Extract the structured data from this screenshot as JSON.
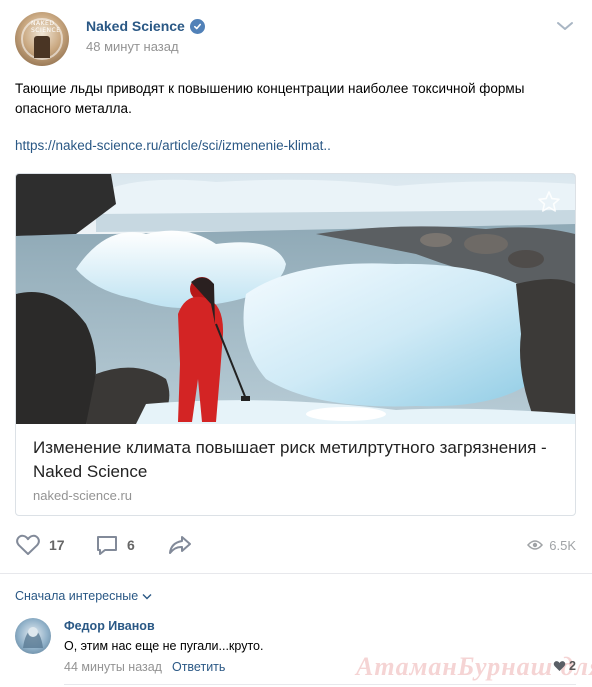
{
  "post": {
    "author": "Naked Science",
    "time": "48 минут назад",
    "text": "Тающие льды приводят к повышению концентрации наиболее токсичной формы опасного металла.",
    "link": "https://naked-science.ru/article/sci/izmenenie-klimat..",
    "avatar_caption": "NAKED SCIENCE"
  },
  "card": {
    "title": "Изменение климата повышает риск метилртутного загрязнения - Naked Science",
    "domain": "naked-science.ru"
  },
  "actions": {
    "likes": "17",
    "comments": "6",
    "views": "6.5K"
  },
  "comments": {
    "sort_label": "Сначала интересные",
    "items": [
      {
        "name": "Федор Иванов",
        "text": "О, этим нас еще не пугали...круто.",
        "time": "44 минуты назад",
        "reply_label": "Ответить",
        "likes": "2"
      }
    ]
  },
  "watermark": "АтаманБурнаш для ЯП",
  "colors": {
    "link": "#2a5885",
    "muted": "#939393",
    "verified": "#5181b8",
    "divider": "#e7e8ec"
  },
  "icons": [
    "verified-icon",
    "chevron-down-icon",
    "star-icon",
    "heart-icon",
    "comment-icon",
    "share-icon",
    "eye-icon"
  ]
}
